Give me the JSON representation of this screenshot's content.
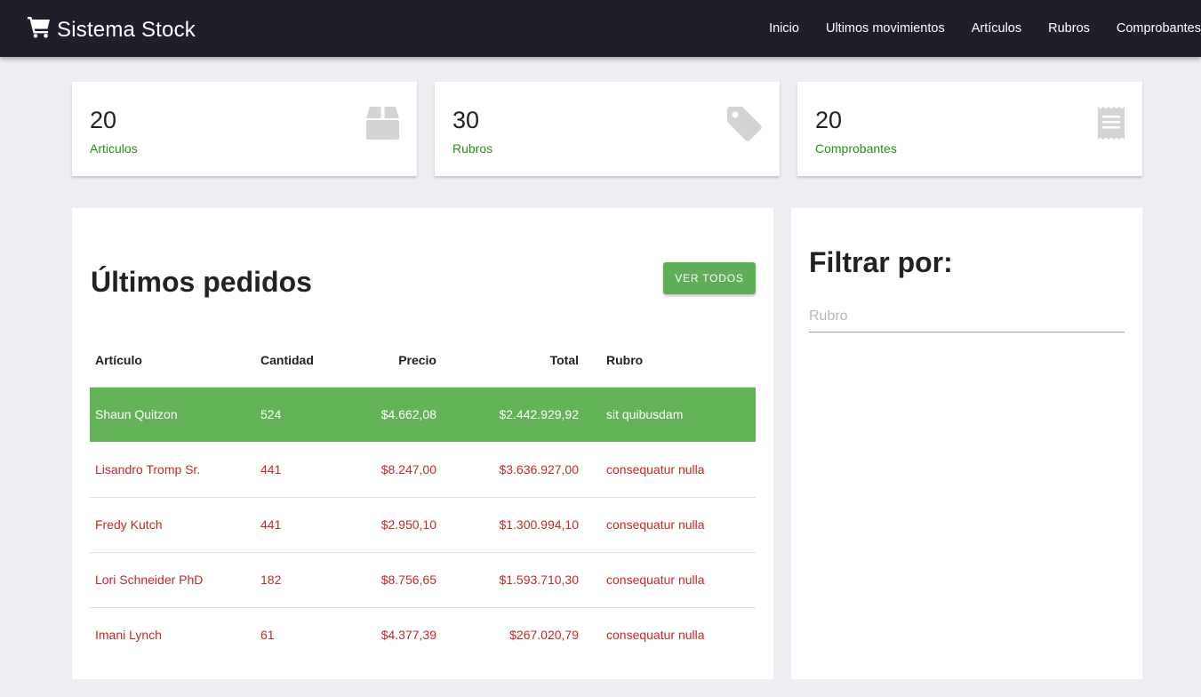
{
  "navbar": {
    "brand": "Sistema Stock",
    "brand_icon": "shopping-cart-icon",
    "links": [
      "Inicio",
      "Ultimos movimientos",
      "Artículos",
      "Rubros",
      "Comprobantes"
    ]
  },
  "stats": [
    {
      "value": "20",
      "label": "Articulos",
      "icon": "box-icon"
    },
    {
      "value": "30",
      "label": "Rubros",
      "icon": "tag-icon"
    },
    {
      "value": "20",
      "label": "Comprobantes",
      "icon": "receipt-icon"
    }
  ],
  "orders": {
    "title": "Últimos pedidos",
    "button_label": "VER TODOS",
    "columns": [
      "Artículo",
      "Cantidad",
      "Precio",
      "Total",
      "Rubro"
    ],
    "rows": [
      [
        "Shaun Quitzon",
        "524",
        "$4.662,08",
        "$2.442.929,92",
        "sit quibusdam"
      ],
      [
        "Lisandro Tromp Sr.",
        "441",
        "$8.247,00",
        "$3.636.927,00",
        "consequatur nulla"
      ],
      [
        "Fredy Kutch",
        "441",
        "$2.950,10",
        "$1.300.994,10",
        "consequatur nulla"
      ],
      [
        "Lori Schneider PhD",
        "182",
        "$8.756,65",
        "$1.593.710,30",
        "consequatur nulla"
      ],
      [
        "Imani Lynch",
        "61",
        "$4.377,39",
        "$267.020,79",
        "consequatur nulla"
      ]
    ]
  },
  "filter": {
    "title": "Filtrar por:",
    "placeholder": "Rubro",
    "value": ""
  },
  "colors": {
    "navbar": "#1f1f2a",
    "accent_green": "#5fad56",
    "label_green": "#2e8b21",
    "row_red": "#c62828",
    "icon_gray": "#d4d4d4"
  }
}
